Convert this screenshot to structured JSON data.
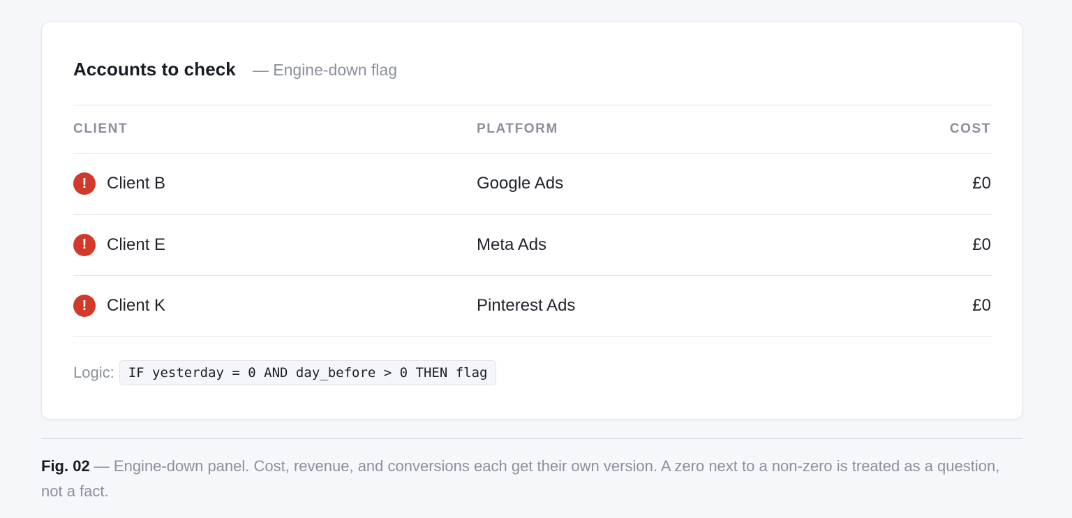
{
  "panel": {
    "title": "Accounts to check",
    "subtitle": "— Engine-down flag"
  },
  "table": {
    "headers": {
      "client": "CLIENT",
      "platform": "PLATFORM",
      "cost": "COST"
    },
    "rows": [
      {
        "status_icon": "alert-icon",
        "client": "Client B",
        "platform": "Google Ads",
        "cost": "£0"
      },
      {
        "status_icon": "alert-icon",
        "client": "Client E",
        "platform": "Meta Ads",
        "cost": "£0"
      },
      {
        "status_icon": "alert-icon",
        "client": "Client K",
        "platform": "Pinterest Ads",
        "cost": "£0"
      }
    ],
    "alert_glyph": "!",
    "alert_color": "#d13a2b"
  },
  "logic": {
    "label": "Logic:",
    "code": "IF yesterday = 0 AND day_before > 0 THEN flag"
  },
  "caption": {
    "label": "Fig. 02",
    "text": " — Engine-down panel. Cost, revenue, and conversions each get their own version. A zero next to a non-zero is treated as a question, not a fact."
  }
}
